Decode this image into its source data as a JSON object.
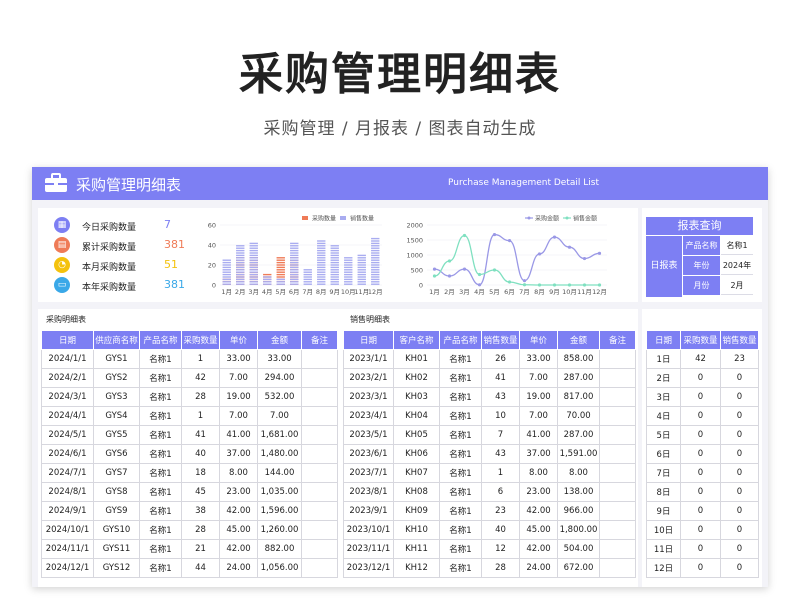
{
  "hero": {
    "title": "采购管理明细表",
    "subtitle": "采购管理  /  月报表  /  图表自动生成"
  },
  "banner": {
    "title": "采购管理明细表",
    "en_title": "Purchase Management Detail List",
    "icon": "briefcase-icon",
    "color": "#7d7ff3"
  },
  "kpis": [
    {
      "label": "今日采购数量",
      "value": "7",
      "color": "#7d7ff3",
      "icon": "calendar-icon"
    },
    {
      "label": "累计采购数量",
      "value": "381",
      "color": "#ef7b57",
      "icon": "stack-icon"
    },
    {
      "label": "本月采购数量",
      "value": "51",
      "color": "#f4c20d",
      "icon": "clock-icon"
    },
    {
      "label": "本年采购数量",
      "value": "381",
      "color": "#3aa8e8",
      "icon": "archive-icon"
    }
  ],
  "chart_data": [
    {
      "type": "bar",
      "categories": [
        "1月",
        "2月",
        "3月",
        "4月",
        "5月",
        "6月",
        "7月",
        "8月",
        "9月",
        "10月",
        "11月",
        "12月"
      ],
      "series": [
        {
          "name": "采购数量",
          "color": "#ef7b57",
          "values": [
            8,
            30,
            28,
            12,
            30,
            30,
            0,
            0,
            0,
            0,
            0,
            0
          ]
        },
        {
          "name": "销售数量",
          "color": "#a9acf0",
          "values": [
            26,
            41,
            43,
            10,
            7,
            43,
            18,
            45,
            41,
            28,
            32,
            48
          ]
        }
      ],
      "ylim": [
        0,
        60
      ],
      "yticks": [
        0,
        20,
        40,
        60
      ],
      "legend": "top-right"
    },
    {
      "type": "line",
      "categories": [
        "1月",
        "2月",
        "3月",
        "4月",
        "5月",
        "6月",
        "7月",
        "8月",
        "9月",
        "10月",
        "11月",
        "12月"
      ],
      "series": [
        {
          "name": "采购金额",
          "color": "#9a98e6",
          "values": [
            530,
            300,
            530,
            7,
            1681,
            1480,
            144,
            1035,
            1596,
            1260,
            882,
            1056
          ]
        },
        {
          "name": "销售金额",
          "color": "#7fe0c0",
          "values": [
            300,
            800,
            1650,
            350,
            500,
            100,
            8,
            0,
            0,
            0,
            0,
            0
          ]
        }
      ],
      "ylim": [
        0,
        2000
      ],
      "yticks": [
        0,
        500,
        1000,
        1500,
        2000
      ],
      "legend": "top-right"
    }
  ],
  "query": {
    "title": "报表查询",
    "side_label": "日报表",
    "rows": [
      {
        "key": "产品名称",
        "value": "名称1"
      },
      {
        "key": "年份",
        "value": "2024年"
      },
      {
        "key": "月份",
        "value": "2月"
      }
    ]
  },
  "purchase": {
    "title": "采购明细表",
    "headers": [
      "日期",
      "供应商名称",
      "产品名称",
      "采购数量",
      "单价",
      "金额",
      "备注"
    ],
    "rows": [
      [
        "2024/1/1",
        "GYS1",
        "名称1",
        "1",
        "33.00",
        "33.00",
        ""
      ],
      [
        "2024/2/1",
        "GYS2",
        "名称1",
        "42",
        "7.00",
        "294.00",
        ""
      ],
      [
        "2024/3/1",
        "GYS3",
        "名称1",
        "28",
        "19.00",
        "532.00",
        ""
      ],
      [
        "2024/4/1",
        "GYS4",
        "名称1",
        "1",
        "7.00",
        "7.00",
        ""
      ],
      [
        "2024/5/1",
        "GYS5",
        "名称1",
        "41",
        "41.00",
        "1,681.00",
        ""
      ],
      [
        "2024/6/1",
        "GYS6",
        "名称1",
        "40",
        "37.00",
        "1,480.00",
        ""
      ],
      [
        "2024/7/1",
        "GYS7",
        "名称1",
        "18",
        "8.00",
        "144.00",
        ""
      ],
      [
        "2024/8/1",
        "GYS8",
        "名称1",
        "45",
        "23.00",
        "1,035.00",
        ""
      ],
      [
        "2024/9/1",
        "GYS9",
        "名称1",
        "38",
        "42.00",
        "1,596.00",
        ""
      ],
      [
        "2024/10/1",
        "GYS10",
        "名称1",
        "28",
        "45.00",
        "1,260.00",
        ""
      ],
      [
        "2024/11/1",
        "GYS11",
        "名称1",
        "21",
        "42.00",
        "882.00",
        ""
      ],
      [
        "2024/12/1",
        "GYS12",
        "名称1",
        "44",
        "24.00",
        "1,056.00",
        ""
      ]
    ]
  },
  "sales": {
    "title": "销售明细表",
    "headers": [
      "日期",
      "客户名称",
      "产品名称",
      "销售数量",
      "单价",
      "金额",
      "备注"
    ],
    "rows": [
      [
        "2023/1/1",
        "KH01",
        "名称1",
        "26",
        "33.00",
        "858.00",
        ""
      ],
      [
        "2023/2/1",
        "KH02",
        "名称1",
        "41",
        "7.00",
        "287.00",
        ""
      ],
      [
        "2023/3/1",
        "KH03",
        "名称1",
        "43",
        "19.00",
        "817.00",
        ""
      ],
      [
        "2023/4/1",
        "KH04",
        "名称1",
        "10",
        "7.00",
        "70.00",
        ""
      ],
      [
        "2023/5/1",
        "KH05",
        "名称1",
        "7",
        "41.00",
        "287.00",
        ""
      ],
      [
        "2023/6/1",
        "KH06",
        "名称1",
        "43",
        "37.00",
        "1,591.00",
        ""
      ],
      [
        "2023/7/1",
        "KH07",
        "名称1",
        "1",
        "8.00",
        "8.00",
        ""
      ],
      [
        "2023/8/1",
        "KH08",
        "名称1",
        "6",
        "23.00",
        "138.00",
        ""
      ],
      [
        "2023/9/1",
        "KH09",
        "名称1",
        "23",
        "42.00",
        "966.00",
        ""
      ],
      [
        "2023/10/1",
        "KH10",
        "名称1",
        "40",
        "45.00",
        "1,800.00",
        ""
      ],
      [
        "2023/11/1",
        "KH11",
        "名称1",
        "12",
        "42.00",
        "504.00",
        ""
      ],
      [
        "2023/12/1",
        "KH12",
        "名称1",
        "28",
        "24.00",
        "672.00",
        ""
      ]
    ]
  },
  "daily": {
    "headers": [
      "日期",
      "采购数量",
      "销售数量"
    ],
    "rows": [
      [
        "1日",
        "42",
        "23"
      ],
      [
        "2日",
        "0",
        "0"
      ],
      [
        "3日",
        "0",
        "0"
      ],
      [
        "4日",
        "0",
        "0"
      ],
      [
        "5日",
        "0",
        "0"
      ],
      [
        "6日",
        "0",
        "0"
      ],
      [
        "7日",
        "0",
        "0"
      ],
      [
        "8日",
        "0",
        "0"
      ],
      [
        "9日",
        "0",
        "0"
      ],
      [
        "10日",
        "0",
        "0"
      ],
      [
        "11日",
        "0",
        "0"
      ],
      [
        "12日",
        "0",
        "0"
      ]
    ]
  }
}
